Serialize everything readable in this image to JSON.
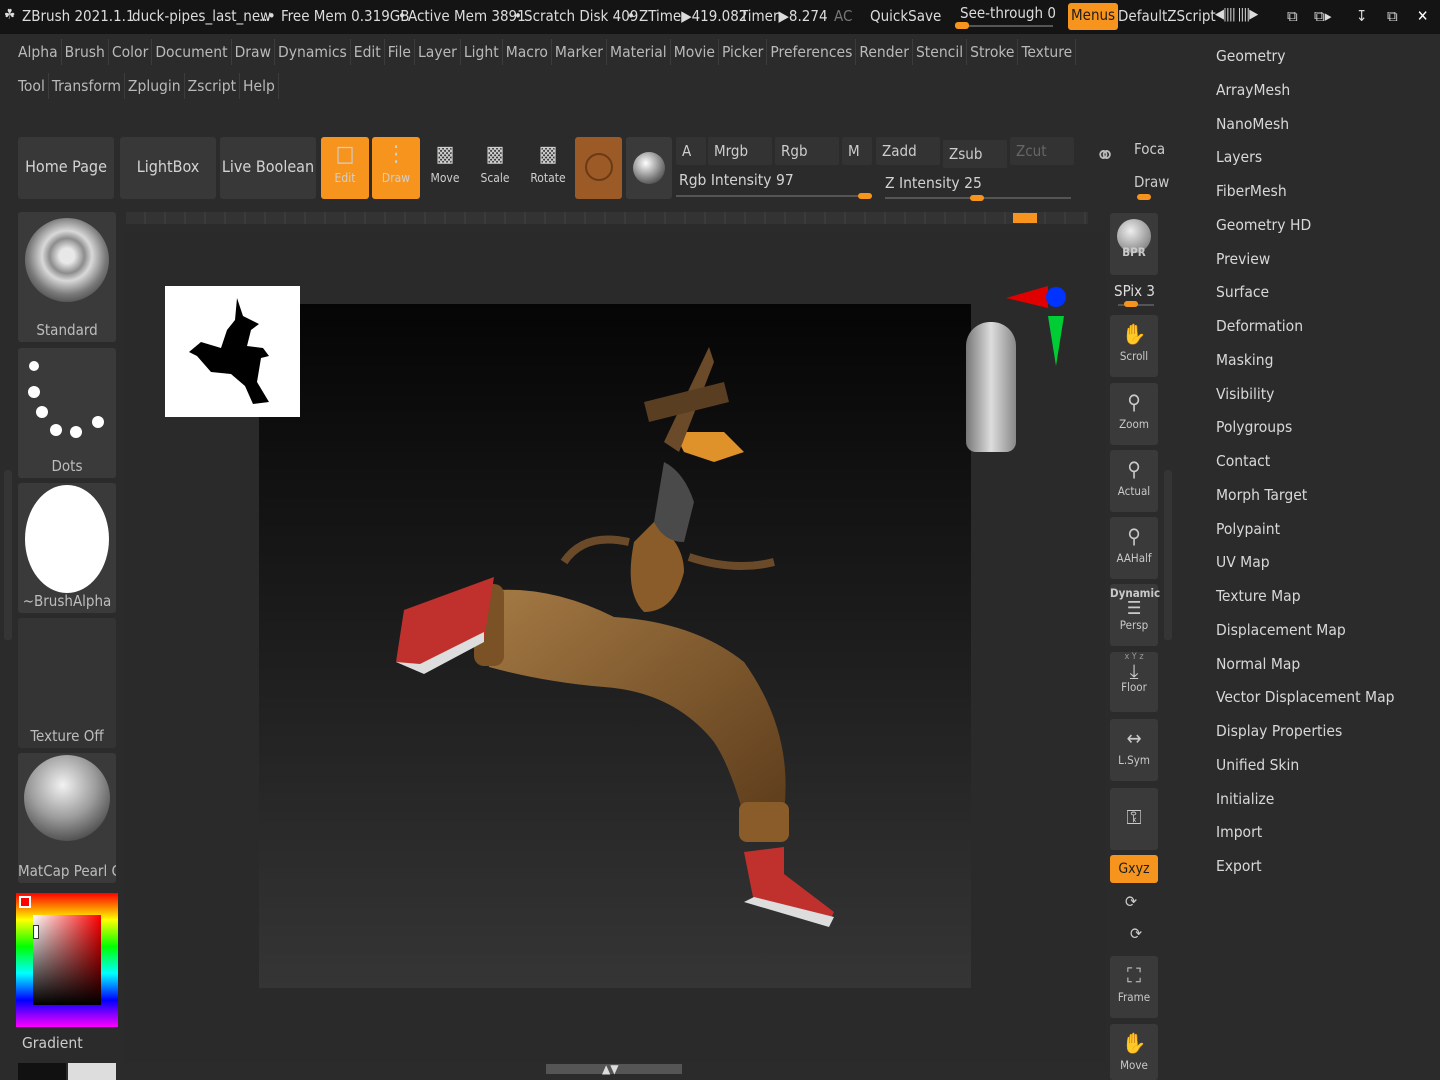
{
  "title_bar": {
    "app": "ZBrush 2021.1.1",
    "document": "duck-pipes_last_new",
    "free_mem": "Free Mem 0.319GB",
    "active_mem": "Active Mem 3891",
    "scratch": "Scratch Disk 409",
    "ztime": "ZTime▶419.082",
    "timer": "Timer▶8.274",
    "ac": "AC",
    "quicksave": "QuickSave",
    "seethrough": "See-through",
    "seethrough_value": "0",
    "menus": "Menus",
    "script": "DefaultZScript"
  },
  "menu_row1": [
    "Alpha",
    "Brush",
    "Color",
    "Document",
    "Draw",
    "Dynamics",
    "Edit",
    "File",
    "Layer",
    "Light",
    "Macro",
    "Marker",
    "Material",
    "Movie",
    "Picker",
    "Preferences",
    "Render",
    "Stencil",
    "Stroke",
    "Texture"
  ],
  "menu_row2": [
    "Tool",
    "Transform",
    "Zplugin",
    "Zscript",
    "Help"
  ],
  "shelf": {
    "home": "Home Page",
    "lightbox": "LightBox",
    "live_boolean": "Live Boolean",
    "edit": "Edit",
    "draw": "Draw",
    "move": "Move",
    "scale": "Scale",
    "rotate": "Rotate",
    "a": "A",
    "mrgb": "Mrgb",
    "rgb": "Rgb",
    "m": "M",
    "zadd": "Zadd",
    "zsub": "Zsub",
    "zcut": "Zcut",
    "rgb_intensity": "Rgb Intensity 97",
    "z_intensity": "Z Intensity 25",
    "focal": "Foca",
    "draw_size": "Draw"
  },
  "left_panel": {
    "brush": "Standard",
    "stroke": "Dots",
    "alpha": "~BrushAlpha",
    "texture": "Texture Off",
    "material": "MatCap Pearl Ca",
    "gradient": "Gradient"
  },
  "right_strip": {
    "bpr": "BPR",
    "spix": "SPix 3",
    "scroll": "Scroll",
    "zoom": "Zoom",
    "actual": "Actual",
    "aahalf": "AAHalf",
    "dynamic": "Dynamic",
    "persp": "Persp",
    "floor": "Floor",
    "lsym": "L.Sym",
    "xyz": "Gxyz",
    "frame": "Frame",
    "move": "Move",
    "floor_axes": "x Y z"
  },
  "tool_palette": [
    "Geometry",
    "ArrayMesh",
    "NanoMesh",
    "Layers",
    "FiberMesh",
    "Geometry HD",
    "Preview",
    "Surface",
    "Deformation",
    "Masking",
    "Visibility",
    "Polygroups",
    "Contact",
    "Morph Target",
    "Polypaint",
    "UV Map",
    "Texture Map",
    "Displacement Map",
    "Normal Map",
    "Vector Displacement Map",
    "Display Properties",
    "Unified Skin",
    "Initialize",
    "Import",
    "Export"
  ],
  "colors": {
    "accent": "#f7941d",
    "bg": "#2b2b2b",
    "panel": "#3a3a3a"
  }
}
